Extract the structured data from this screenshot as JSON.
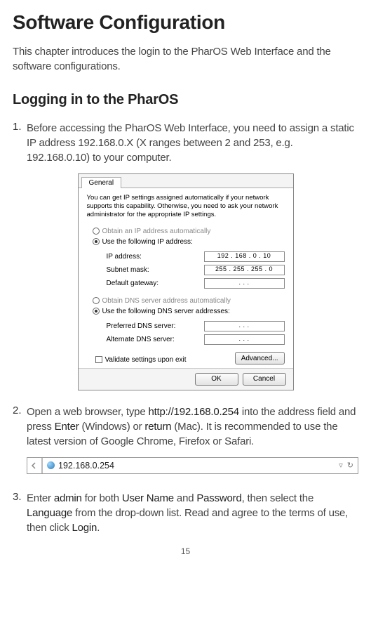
{
  "title": "Software Configuration",
  "intro": "This chapter introduces the login to the PharOS Web Interface and the software configurations.",
  "section_heading": "Logging in to the PharOS",
  "steps": {
    "s1": {
      "num": "1.",
      "text": "Before accessing the PharOS Web Interface, you need to assign a static IP address 192.168.0.X (X ranges between 2 and 253, e.g. 192.168.0.10) to your computer."
    },
    "s2": {
      "num": "2.",
      "p1": "Open a web browser, type ",
      "url": "http://192.168.0.254",
      "p2": " into the address field and press ",
      "enter": "Enter",
      "p3": " (Windows) or ",
      "return": "return",
      "p4": " (Mac). It is recommended to use the latest version of Google Chrome, Firefox or Safari."
    },
    "s3": {
      "num": "3.",
      "p1": "Enter ",
      "admin": "admin",
      "p2": " for both ",
      "uname": "User Name",
      "p3": " and ",
      "pword": "Password",
      "p4": ", then select the ",
      "lang": "Language",
      "p5": " from the drop-down list. Read and agree to the terms of use, then click ",
      "login": "Login",
      "p6": "."
    }
  },
  "dialog": {
    "tab": "General",
    "hint": "You can get IP settings assigned automatically if your network supports this capability. Otherwise, you need to ask your network administrator for the appropriate IP settings.",
    "obtain_ip": "Obtain an IP address automatically",
    "use_ip": "Use the following IP address:",
    "ip_lbl": "IP address:",
    "ip_val": "192 . 168 .  0  .  10",
    "mask_lbl": "Subnet mask:",
    "mask_val": "255 . 255 . 255 .  0",
    "gw_lbl": "Default gateway:",
    "gw_val": ".        .        .",
    "obtain_dns": "Obtain DNS server address automatically",
    "use_dns": "Use the following DNS server addresses:",
    "pdns_lbl": "Preferred DNS server:",
    "pdns_val": ".        .        .",
    "adns_lbl": "Alternate DNS server:",
    "adns_val": ".        .        .",
    "validate": "Validate settings upon exit",
    "advanced": "Advanced...",
    "ok": "OK",
    "cancel": "Cancel"
  },
  "addressbar": {
    "url": "192.168.0.254",
    "dropdown": "▿",
    "reload": "↻"
  },
  "page_num": "15"
}
